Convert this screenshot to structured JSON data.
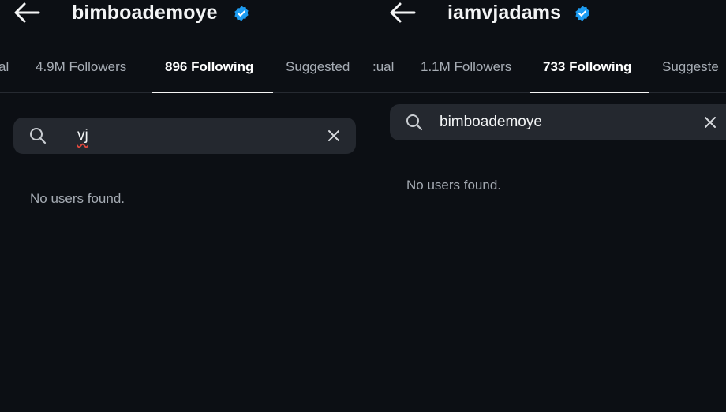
{
  "left": {
    "username": "bimboademoye",
    "tabs": [
      "al",
      "4.9M Followers",
      "896 Following",
      "Suggested"
    ],
    "search": {
      "value": "vj"
    },
    "empty_message": "No users found."
  },
  "right": {
    "username": "iamvjadams",
    "tabs": [
      ":ual",
      "1.1M Followers",
      "733 Following",
      "Suggeste"
    ],
    "search": {
      "value": "bimboademoye"
    },
    "empty_message": "No users found."
  },
  "icons": {
    "back": "arrow-left-icon",
    "verified": "verified-badge-icon",
    "search": "magnifier-icon",
    "clear": "close-x-icon"
  },
  "colors": {
    "background": "#0c0f14",
    "search_bg": "#24282f",
    "verified": "#1d9bf0",
    "muted_text": "#a7adb5",
    "spellcheck": "#e0483e"
  }
}
